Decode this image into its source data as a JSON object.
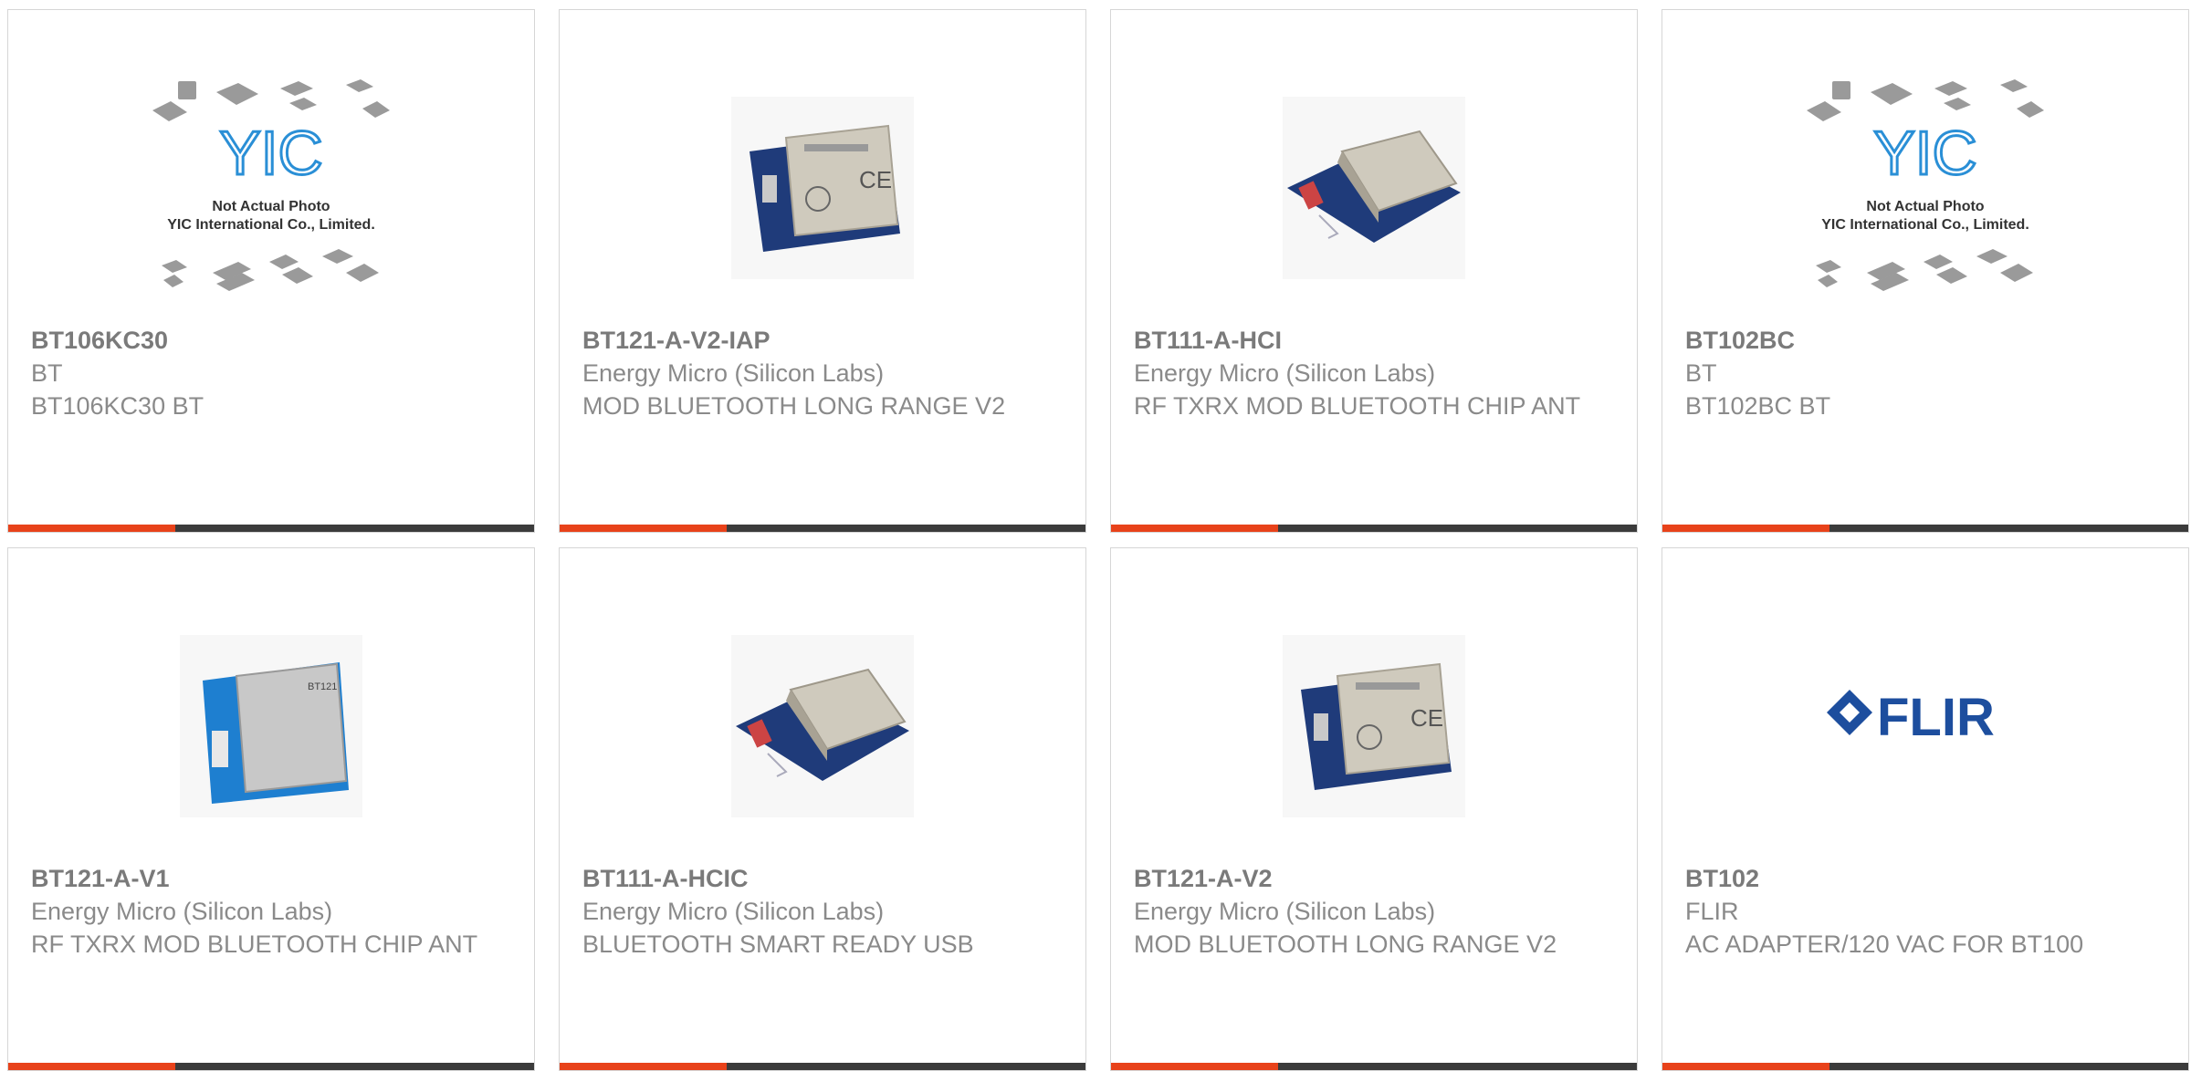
{
  "products": [
    {
      "part": "BT106KC30",
      "manufacturer": "BT",
      "description": "BT106KC30 BT",
      "image": "yic-placeholder-icon"
    },
    {
      "part": "BT121-A-V2-IAP",
      "manufacturer": "Energy Micro (Silicon Labs)",
      "description": "MOD BLUETOOTH LONG RANGE V2",
      "image": "bluetooth-module-ce-icon"
    },
    {
      "part": "BT111-A-HCI",
      "manufacturer": "Energy Micro (Silicon Labs)",
      "description": "RF TXRX MOD BLUETOOTH CHIP ANT",
      "image": "bluetooth-module-icon"
    },
    {
      "part": "BT102BC",
      "manufacturer": "BT",
      "description": "BT102BC BT",
      "image": "yic-placeholder-icon"
    },
    {
      "part": "BT121-A-V1",
      "manufacturer": "Energy Micro (Silicon Labs)",
      "description": "RF TXRX MOD BLUETOOTH CHIP ANT",
      "image": "bt121-module-icon"
    },
    {
      "part": "BT111-A-HCIC",
      "manufacturer": "Energy Micro (Silicon Labs)",
      "description": "BLUETOOTH SMART READY USB",
      "image": "bluetooth-module-icon"
    },
    {
      "part": "BT121-A-V2",
      "manufacturer": "Energy Micro (Silicon Labs)",
      "description": "MOD BLUETOOTH LONG RANGE V2",
      "image": "bluetooth-module-ce-icon"
    },
    {
      "part": "BT102",
      "manufacturer": "FLIR",
      "description": "AC ADAPTER/120 VAC FOR BT100",
      "image": "flir-logo"
    }
  ],
  "placeholder": {
    "logo": "YIC",
    "line1": "Not Actual Photo",
    "line2": "YIC International Co., Limited."
  },
  "module_labels": {
    "ce_mark": "CE",
    "bt121": "BT121"
  },
  "flir_logo_text": "FLIR",
  "colors": {
    "accent": "#e8421a",
    "bar_dark": "#3b3b3b",
    "text": "#8a8a8a",
    "flir_blue": "#1d4e9e",
    "yic_blue": "#2a8fd6"
  }
}
